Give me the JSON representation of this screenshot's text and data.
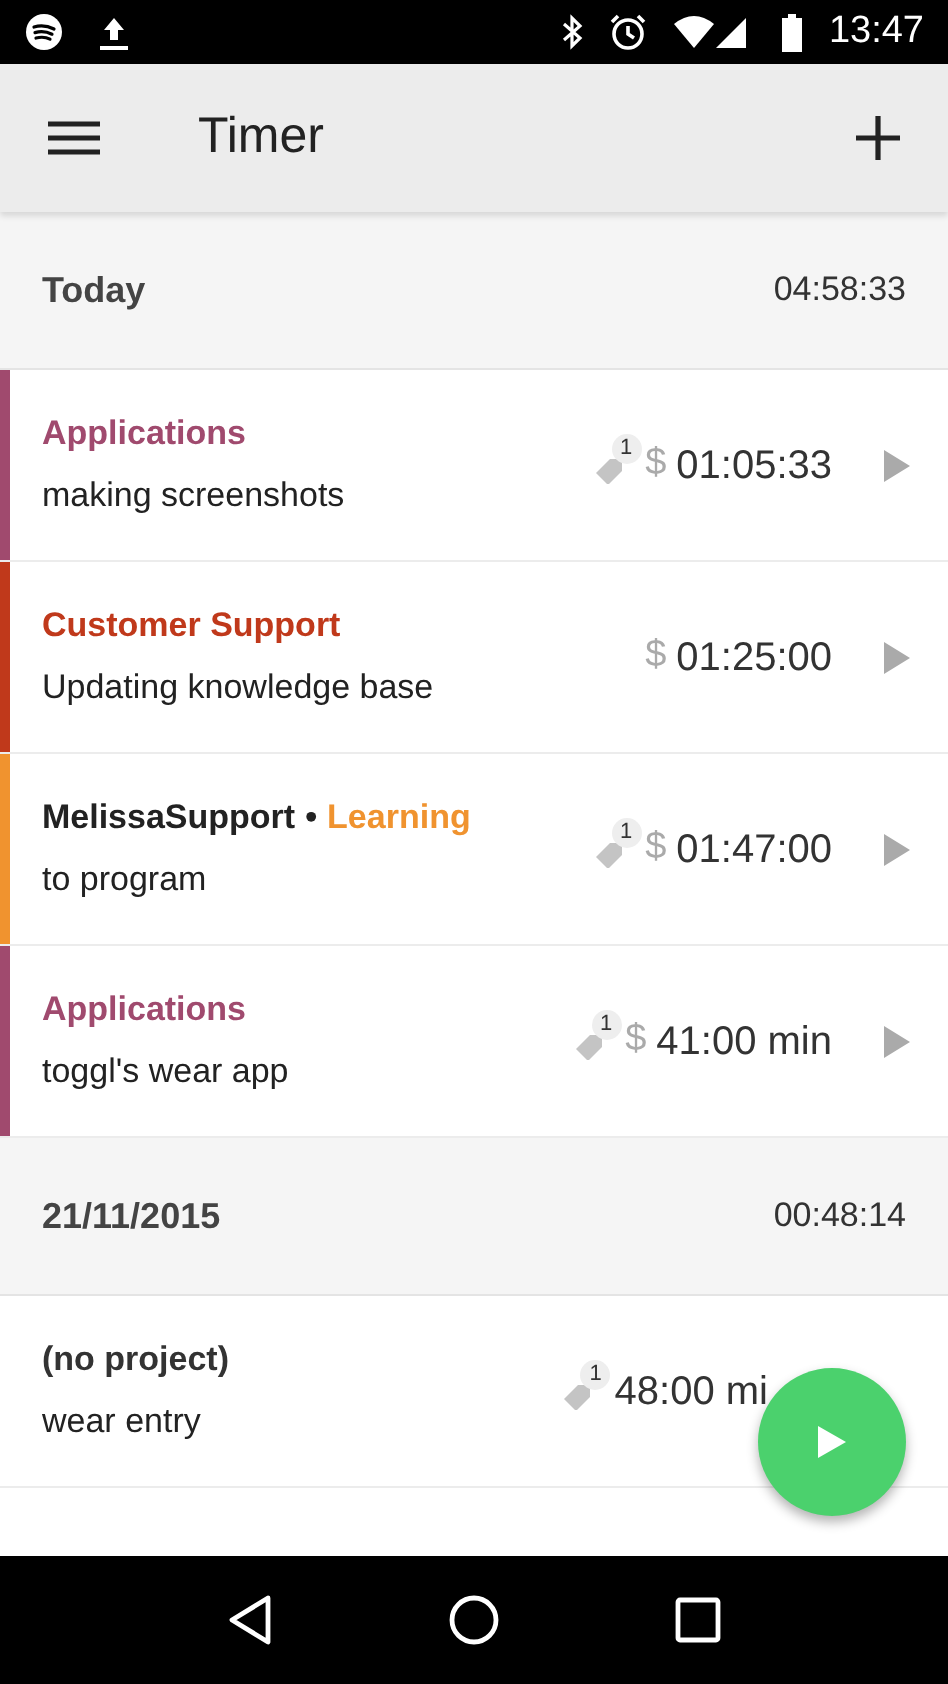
{
  "status_bar": {
    "time": "13:47"
  },
  "app_bar": {
    "title": "Timer"
  },
  "sections": [
    {
      "date": "Today",
      "total": "04:58:33",
      "entries": [
        {
          "project": "Applications",
          "color": "#a04a6e",
          "description": "making screenshots",
          "tags": "1",
          "currency": "$",
          "duration": "01:05:33",
          "play": true
        },
        {
          "project": "Customer Support",
          "color": "#c0391b",
          "description": "Updating knowledge base",
          "currency": "$",
          "duration": "01:25:00",
          "play": true
        },
        {
          "project": "Learning",
          "color": "#f0932f",
          "client": "MelissaSupport",
          "separator": "•",
          "description": "to program",
          "tags": "1",
          "currency": "$",
          "duration": "01:47:00",
          "play": true
        },
        {
          "project": "Applications",
          "color": "#a04a6e",
          "description": "toggl's wear app",
          "tags": "1",
          "currency": "$",
          "duration": "41:00 min",
          "play": true
        }
      ]
    },
    {
      "date": "21/11/2015",
      "total": "00:48:14",
      "entries": [
        {
          "project": "(no project)",
          "description": "wear entry",
          "tags": "1",
          "duration": "48:00 mi"
        }
      ]
    }
  ]
}
